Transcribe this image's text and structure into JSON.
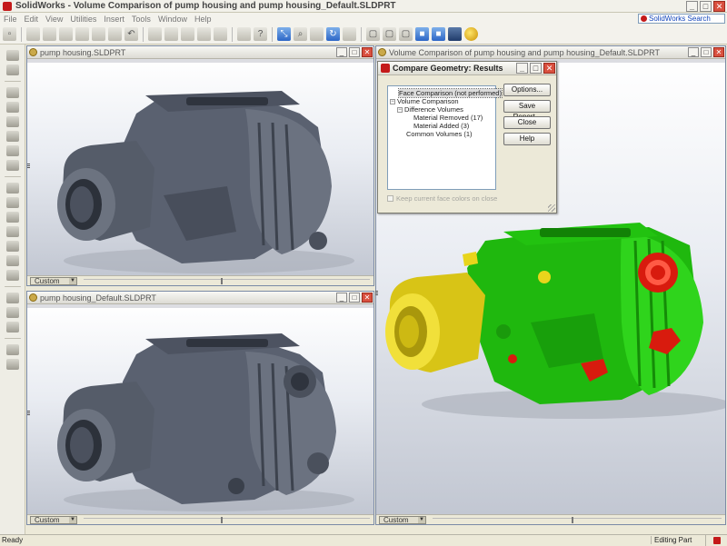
{
  "app": {
    "title": "SolidWorks - Volume Comparison of pump housing and pump housing_Default.SLDPRT",
    "search_label": "SolidWorks Search"
  },
  "menu": [
    "File",
    "Edit",
    "View",
    "Utilities",
    "Insert",
    "Tools",
    "Window",
    "Help"
  ],
  "documents": {
    "top_left": {
      "title": "pump housing.SLDPRT",
      "view": "Custom"
    },
    "bottom_left": {
      "title": "pump housing_Default.SLDPRT",
      "view": "Custom"
    },
    "right": {
      "title": "Volume Comparison of pump housing and pump housing_Default.SLDPRT",
      "view": "Custom"
    }
  },
  "dialog": {
    "title": "Compare Geometry: Results",
    "tree": [
      {
        "label": "Face Comparison (not performed)",
        "level": 0,
        "selected": true
      },
      {
        "label": "Volume Comparison",
        "level": 0,
        "expander": "−"
      },
      {
        "label": "Difference Volumes",
        "level": 1,
        "expander": "−"
      },
      {
        "label": "Material Removed (17)",
        "level": 2
      },
      {
        "label": "Material Added (3)",
        "level": 2
      },
      {
        "label": "Common Volumes (1)",
        "level": 1
      }
    ],
    "buttons": {
      "options": "Options...",
      "save_report": "Save Report...",
      "close": "Close",
      "help": "Help"
    },
    "keep_colors": "Keep current face colors on close"
  },
  "status": {
    "ready": "Ready",
    "mode": "Editing Part"
  },
  "colors": {
    "common": "#26cc12",
    "added": "#e8d51c",
    "removed": "#d81b0e",
    "body": "#5f6672"
  }
}
